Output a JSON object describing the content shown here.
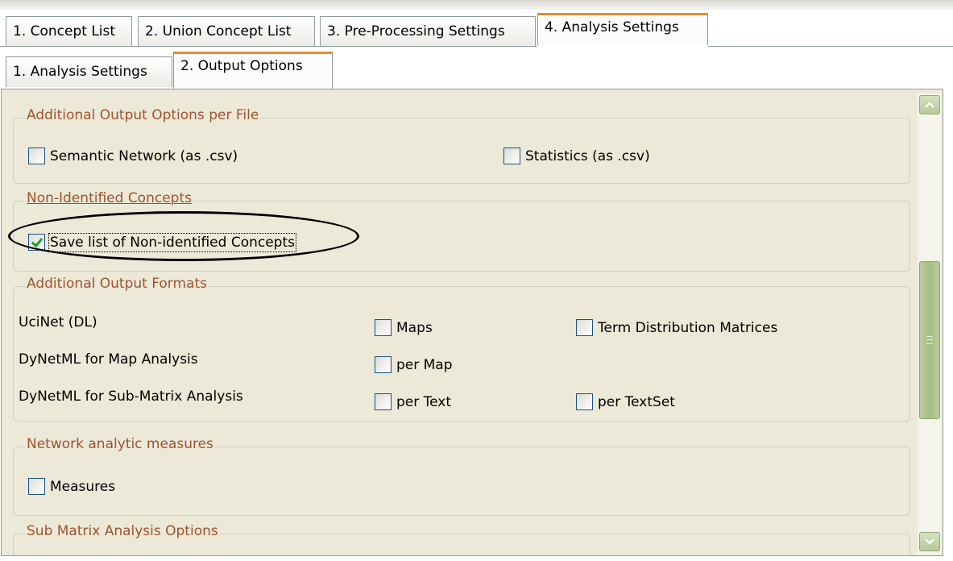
{
  "main_tabs": [
    {
      "label": "1. Concept List"
    },
    {
      "label": "2. Union Concept List"
    },
    {
      "label": "3. Pre-Processing Settings"
    },
    {
      "label": "4. Analysis Settings"
    }
  ],
  "sub_tabs": [
    {
      "label": "1. Analysis Settings"
    },
    {
      "label": "2. Output Options"
    }
  ],
  "sections": {
    "per_file": {
      "title": "Additional Output Options per File",
      "semantic_network": {
        "label": "Semantic Network (as .csv)",
        "checked": false
      },
      "statistics": {
        "label": "Statistics (as .csv)",
        "checked": false
      }
    },
    "non_identified": {
      "title": "Non-Identified Concepts",
      "save_list": {
        "label": "Save list of Non-identified Concepts",
        "checked": true
      }
    },
    "formats": {
      "title": "Additional Output Formats",
      "rows": [
        {
          "label": "UciNet (DL)"
        },
        {
          "label": "DyNetML for Map Analysis"
        },
        {
          "label": "DyNetML for Sub-Matrix Analysis"
        }
      ],
      "maps": {
        "label": "Maps",
        "checked": false
      },
      "term_matrices": {
        "label": "Term Distribution Matrices",
        "checked": false
      },
      "per_map": {
        "label": "per Map",
        "checked": false
      },
      "per_text": {
        "label": "per Text",
        "checked": false
      },
      "per_textset": {
        "label": "per TextSet",
        "checked": false
      }
    },
    "measures": {
      "title": "Network analytic measures",
      "measures": {
        "label": "Measures",
        "checked": false
      }
    },
    "sub_matrix": {
      "title": "Sub Matrix Analysis Options"
    }
  },
  "colors": {
    "accent_tab": "#e68b2c",
    "section_title": "#a0522d",
    "scrollbar": "#b5c99b",
    "panel_bg": "#ece9d8"
  },
  "icons": [
    "scroll-up-arrow-icon",
    "scroll-down-arrow-icon",
    "checkmark-icon"
  ]
}
